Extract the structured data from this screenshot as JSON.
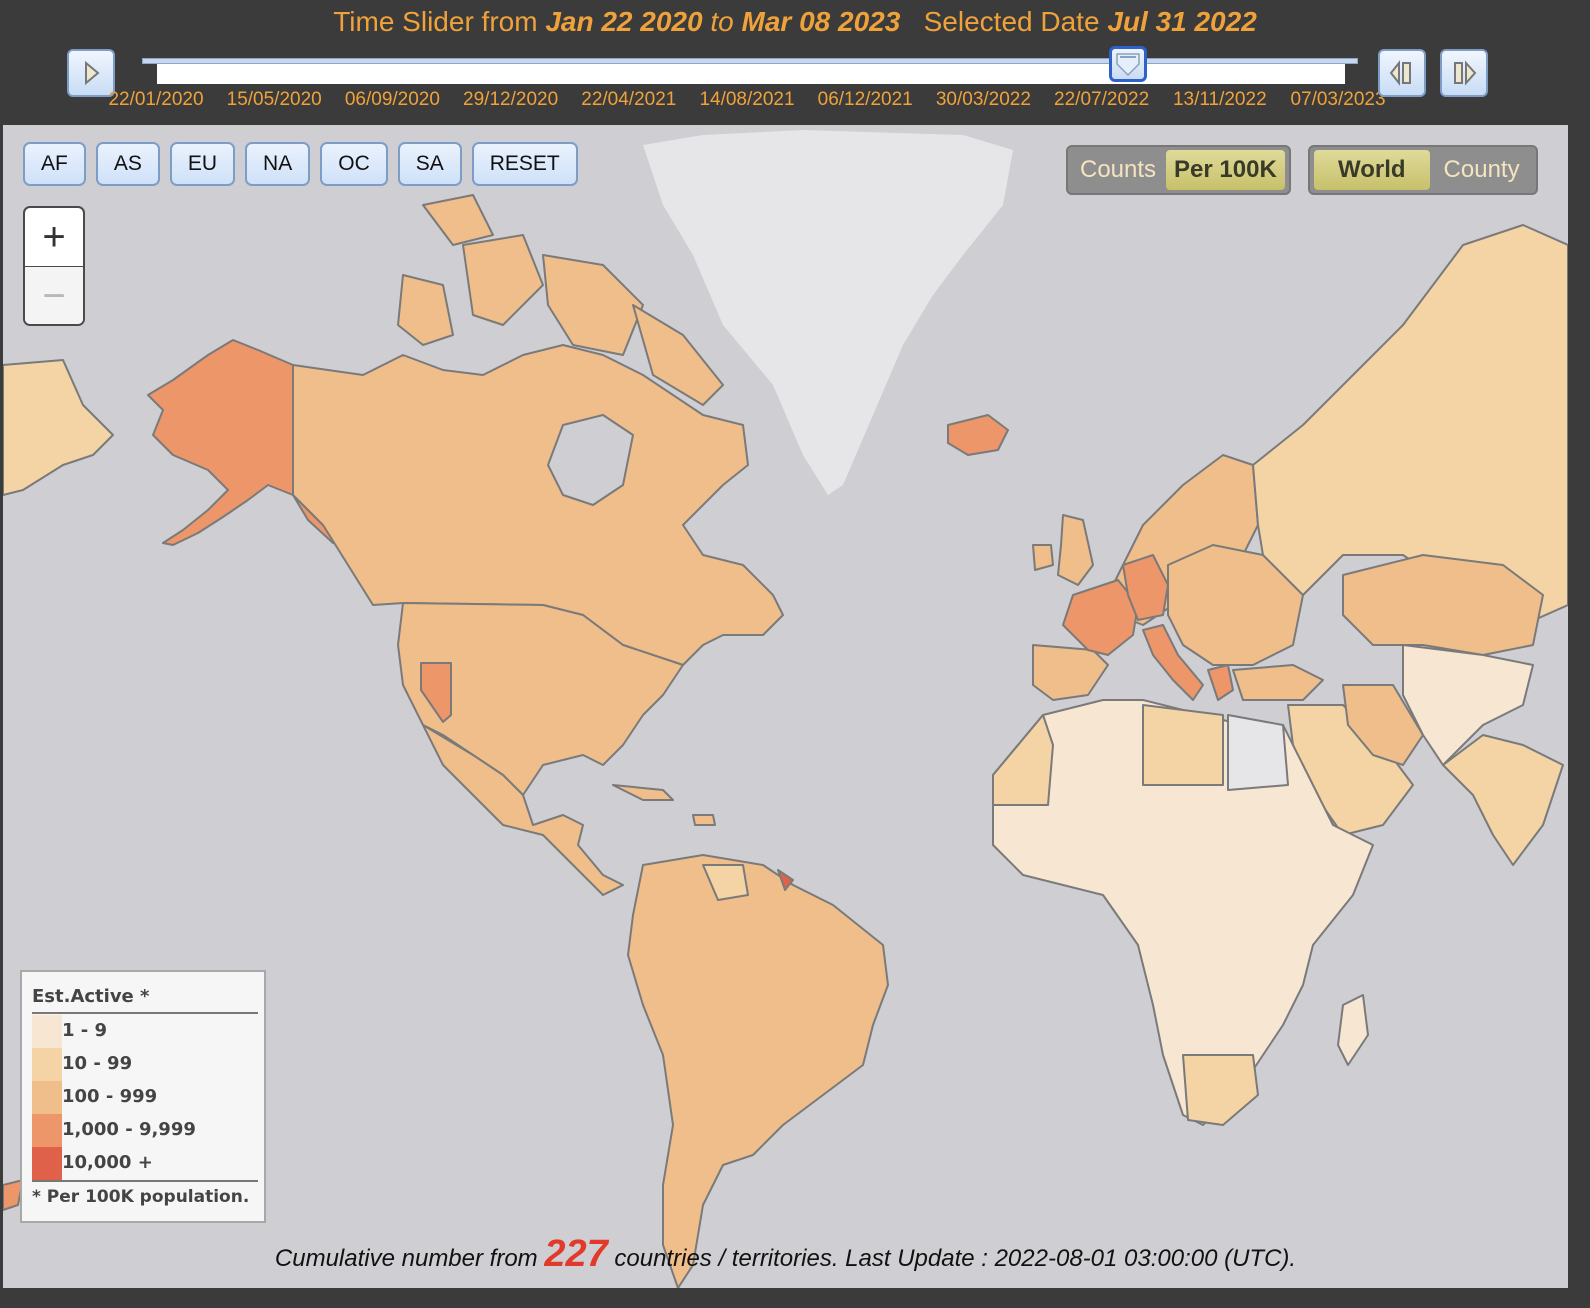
{
  "header": {
    "prefix": "Time Slider from ",
    "start_date": "Jan 22 2020",
    "to_word": " to ",
    "end_date": "Mar 08 2023",
    "selected_label": "   Selected Date ",
    "selected_date": "Jul 31 2022"
  },
  "slider": {
    "position_fraction": 0.817,
    "ticks": [
      "22/01/2020",
      "15/05/2020",
      "06/09/2020",
      "29/12/2020",
      "22/04/2021",
      "14/08/2021",
      "06/12/2021",
      "30/03/2022",
      "22/07/2022",
      "13/11/2022",
      "07/03/2023"
    ],
    "play_icon": "play-icon",
    "step_back_icon": "step-back-icon",
    "step_forward_icon": "step-forward-icon"
  },
  "region_buttons": [
    "AF",
    "AS",
    "EU",
    "NA",
    "OC",
    "SA",
    "RESET"
  ],
  "zoom": {
    "in": "+",
    "out": "−"
  },
  "metric_toggle": {
    "options": [
      "Counts",
      "Per 100K"
    ],
    "selected": "Per 100K"
  },
  "scope_toggle": {
    "options": [
      "World",
      "County"
    ],
    "selected": "World"
  },
  "legend": {
    "title": "Est.Active *",
    "items": [
      {
        "label": "1 - 9",
        "color": "#f6e6d2"
      },
      {
        "label": "10 - 99",
        "color": "#f4d4a4"
      },
      {
        "label": "100 - 999",
        "color": "#efbe8b"
      },
      {
        "label": "1,000 - 9,999",
        "color": "#ec9669"
      },
      {
        "label": "10,000 +",
        "color": "#e0614a"
      }
    ],
    "note": "* Per 100K population."
  },
  "colors": {
    "ocean": "#cfcfd3",
    "greenland": "#e6e6e8",
    "border": "#7a7a7a",
    "accent_text": "#f0a23a"
  },
  "footer": {
    "prefix": "Cumulative number from ",
    "count": "227",
    "suffix": " countries / territories. Last Update : 2022-08-01 03:00:00 (UTC)."
  }
}
